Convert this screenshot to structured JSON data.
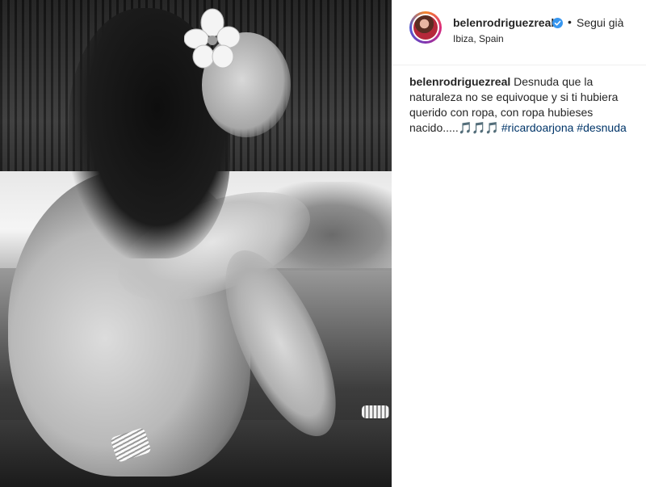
{
  "post": {
    "username": "belenrodriguezreal",
    "separator": "•",
    "follow_label": "Segui già",
    "location": "Ibiza, Spain"
  },
  "caption": {
    "username": "belenrodriguezreal",
    "text": "Desnuda que la naturaleza no se equivoque y si ti hubiera querido con ropa, con ropa hubieses nacido.....",
    "notes": "🎵🎵🎵",
    "hashtags": [
      "#ricardoarjona",
      "#desnuda"
    ]
  },
  "colors": {
    "link": "#003569",
    "verified": "#3897f0",
    "text": "#262626"
  },
  "icons": {
    "verified": "verified-badge-icon",
    "avatar": "story-ring-avatar"
  }
}
